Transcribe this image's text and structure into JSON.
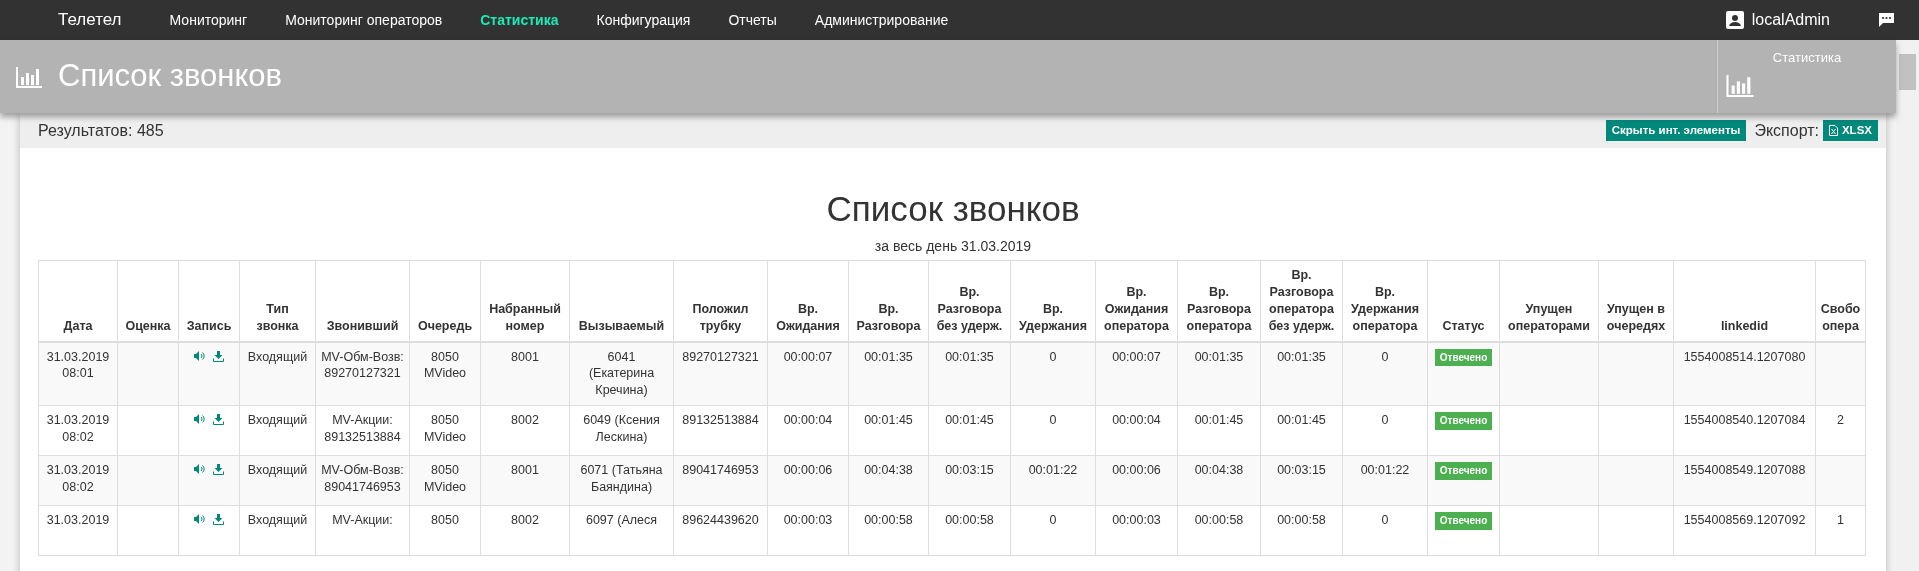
{
  "navbar": {
    "brand": "Телетел",
    "items": [
      {
        "label": "Мониторинг",
        "selected": false
      },
      {
        "label": "Мониторинг операторов",
        "selected": false
      },
      {
        "label": "Статистика",
        "selected": true
      },
      {
        "label": "Конфигурация",
        "selected": false
      },
      {
        "label": "Отчеты",
        "selected": false
      },
      {
        "label": "Администрирование",
        "selected": false
      }
    ],
    "user": "localAdmin"
  },
  "header": {
    "title": "Список звонков",
    "side_panel": {
      "label": "Статистика"
    }
  },
  "toolbar": {
    "results": "Результатов: 485",
    "hide_button": "Скрыть инт. элементы",
    "export_label": "Экспорт:",
    "export_button": "XLSX"
  },
  "report": {
    "title": "Список звонков",
    "subtitle": "за весь день 31.03.2019"
  },
  "table": {
    "columns": [
      {
        "label": "Дата",
        "kind": "text"
      },
      {
        "label": "Оценка",
        "kind": "text"
      },
      {
        "label": "Запись",
        "kind": "record"
      },
      {
        "label": "Тип звонка",
        "kind": "text"
      },
      {
        "label": "Звонивший",
        "kind": "text"
      },
      {
        "label": "Очередь",
        "kind": "text"
      },
      {
        "label": "Набранный номер",
        "kind": "text"
      },
      {
        "label": "Вызываемый",
        "kind": "text"
      },
      {
        "label": "Положил трубку",
        "kind": "text"
      },
      {
        "label": "Вр. Ожидания",
        "kind": "text"
      },
      {
        "label": "Вр. Разговора",
        "kind": "text"
      },
      {
        "label": "Вр. Разговора без удерж.",
        "kind": "text"
      },
      {
        "label": "Вр. Удержания",
        "kind": "text"
      },
      {
        "label": "Вр. Ожидания оператора",
        "kind": "text"
      },
      {
        "label": "Вр. Разговора оператора",
        "kind": "text"
      },
      {
        "label": "Вр. Разговора оператора без удерж.",
        "kind": "text"
      },
      {
        "label": "Вр. Удержания оператора",
        "kind": "text"
      },
      {
        "label": "Статус",
        "kind": "status"
      },
      {
        "label": "Упущен операторами",
        "kind": "text"
      },
      {
        "label": "Упущен в очередях",
        "kind": "text"
      },
      {
        "label": "linkedid",
        "kind": "text"
      },
      {
        "label": "Свобо опера",
        "kind": "text"
      }
    ],
    "rows": [
      [
        "31.03.2019 08:01",
        null,
        null,
        "Входящий",
        "MV-Обм-Возв: 89270127321",
        "8050 MVideo",
        "8001",
        "6041 (Екатерина Кречина)",
        "89270127321",
        "00:00:07",
        "00:01:35",
        "00:01:35",
        "0",
        "00:00:07",
        "00:01:35",
        "00:01:35",
        "0",
        "Отвечено",
        null,
        null,
        "1554008514.1207080",
        null
      ],
      [
        "31.03.2019 08:02",
        null,
        null,
        "Входящий",
        "MV-Акции: 89132513884",
        "8050 MVideo",
        "8002",
        "6049 (Ксения Лескина)",
        "89132513884",
        "00:00:04",
        "00:01:45",
        "00:01:45",
        "0",
        "00:00:04",
        "00:01:45",
        "00:01:45",
        "0",
        "Отвечено",
        null,
        null,
        "1554008540.1207084",
        "2"
      ],
      [
        "31.03.2019 08:02",
        null,
        null,
        "Входящий",
        "MV-Обм-Возв: 89041746953",
        "8050 MVideo",
        "8001",
        "6071 (Татьяна Баяндина)",
        "89041746953",
        "00:00:06",
        "00:04:38",
        "00:03:15",
        "00:01:22",
        "00:00:06",
        "00:04:38",
        "00:03:15",
        "00:01:22",
        "Отвечено",
        null,
        null,
        "1554008549.1207088",
        null
      ],
      [
        "31.03.2019",
        null,
        null,
        "Входящий",
        "MV-Акции:",
        "8050",
        "8002",
        "6097 (Алеся",
        "89624439620",
        "00:00:03",
        "00:00:58",
        "00:00:58",
        "0",
        "00:00:03",
        "00:00:58",
        "00:00:58",
        "0",
        "Отвечено",
        null,
        null,
        "1554008569.1207092",
        "1"
      ]
    ]
  }
}
